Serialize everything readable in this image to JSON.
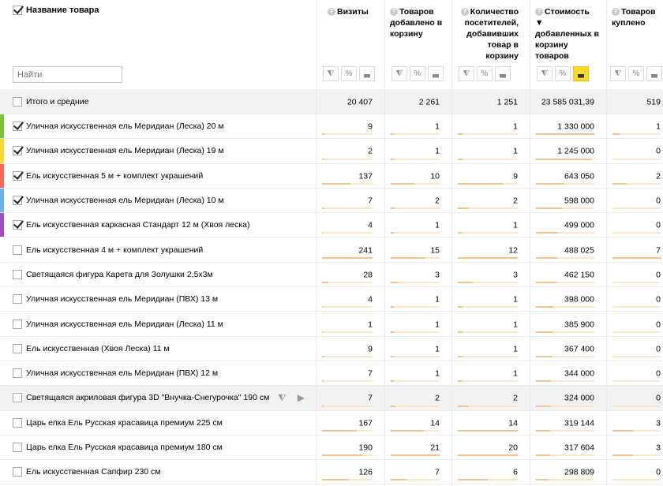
{
  "header": {
    "name_col": "Название товара",
    "search_placeholder": "Найти",
    "metrics": [
      {
        "title": "Визиты",
        "active_tool": false
      },
      {
        "title": "Товаров добавлено в корзину",
        "active_tool": false
      },
      {
        "title": "Количество посетителей, добавивших товар в корзину",
        "active_tool": false
      },
      {
        "title": "Стоимость ▼ добавленных в корзину товаров",
        "active_tool": true
      },
      {
        "title": "Товаров куплено",
        "active_tool": false
      }
    ],
    "tool_icons": [
      "filter-icon",
      "percent-icon",
      "chart-bars-icon"
    ]
  },
  "total": {
    "label": "Итого и средние",
    "values": [
      "20 407",
      "2 261",
      "1 251",
      "23 585 031,39",
      "519"
    ]
  },
  "rows": [
    {
      "label": "Уличная искусственная ель Меридиан (Леска) 20 м",
      "checked": true,
      "stripe": "#7cbf3a",
      "values": [
        "9",
        "1",
        "1",
        "1 330 000",
        "1"
      ],
      "fills": [
        0.04,
        0.07,
        0.08,
        1.0,
        0.14
      ]
    },
    {
      "label": "Уличная искусственная ель Меридиан (Леска) 19 м",
      "checked": true,
      "stripe": "#f5d93b",
      "values": [
        "2",
        "1",
        "1",
        "1 245 000",
        "0"
      ],
      "fills": [
        0.01,
        0.07,
        0.08,
        0.94,
        0
      ]
    },
    {
      "label": "Ель искусственная 5 м + комплект украшений",
      "checked": true,
      "stripe": "#f26b5b",
      "values": [
        "137",
        "10",
        "9",
        "643 050",
        "2"
      ],
      "fills": [
        0.57,
        0.48,
        0.75,
        0.48,
        0.29
      ]
    },
    {
      "label": "Уличная искусственная ель Меридиан (Леска) 10 м",
      "checked": true,
      "stripe": "#6fb1e8",
      "values": [
        "7",
        "2",
        "2",
        "598 000",
        "0"
      ],
      "fills": [
        0.03,
        0.1,
        0.17,
        0.45,
        0
      ]
    },
    {
      "label": "Ель искусственная каркасная Стандарт 12 м (Хвоя леска)",
      "checked": true,
      "stripe": "#9b4fc2",
      "values": [
        "4",
        "1",
        "1",
        "499 000",
        "0"
      ],
      "fills": [
        0.02,
        0.07,
        0.08,
        0.38,
        0
      ]
    },
    {
      "label": "Ель искусственная 4 м + комплект украшений",
      "checked": false,
      "stripe": "",
      "values": [
        "241",
        "15",
        "12",
        "488 025",
        "7"
      ],
      "fills": [
        1.0,
        0.71,
        1.0,
        0.37,
        1.0
      ]
    },
    {
      "label": "Светящаяся фигура Карета для Золушки 2,5х3м",
      "checked": false,
      "stripe": "",
      "values": [
        "28",
        "3",
        "3",
        "462 150",
        "0"
      ],
      "fills": [
        0.12,
        0.14,
        0.25,
        0.35,
        0
      ]
    },
    {
      "label": "Уличная искусственная ель Меридиан (ПВХ) 13 м",
      "checked": false,
      "stripe": "",
      "values": [
        "4",
        "1",
        "1",
        "398 000",
        "0"
      ],
      "fills": [
        0.02,
        0.07,
        0.08,
        0.3,
        0
      ]
    },
    {
      "label": "Уличная искусственная ель Меридиан (Леска) 11 м",
      "checked": false,
      "stripe": "",
      "values": [
        "1",
        "1",
        "1",
        "385 900",
        "0"
      ],
      "fills": [
        0.01,
        0.07,
        0.08,
        0.29,
        0
      ]
    },
    {
      "label": "Ель искусственная (Хвоя Леска) 11 м",
      "checked": false,
      "stripe": "",
      "values": [
        "9",
        "1",
        "1",
        "367 400",
        "0"
      ],
      "fills": [
        0.04,
        0.07,
        0.08,
        0.28,
        0
      ]
    },
    {
      "label": "Уличная искусственная ель Меридиан (ПВХ) 12 м",
      "checked": false,
      "stripe": "",
      "values": [
        "7",
        "1",
        "1",
        "344 000",
        "0"
      ],
      "fills": [
        0.03,
        0.07,
        0.08,
        0.26,
        0
      ]
    },
    {
      "label": "Светящаяся акриловая фигура 3D \"Внучка-Снегурочка\" 190 см",
      "checked": false,
      "stripe": "",
      "hover": true,
      "values": [
        "7",
        "2",
        "2",
        "324 000",
        "0"
      ],
      "fills": [
        0.03,
        0.1,
        0.17,
        0.24,
        0
      ]
    },
    {
      "label": "Царь елка Ель Русская красавица премиум 225 см",
      "checked": false,
      "stripe": "",
      "values": [
        "167",
        "14",
        "14",
        "319 144",
        "3"
      ],
      "fills": [
        0.69,
        0.67,
        1.0,
        0.24,
        0.43
      ]
    },
    {
      "label": "Царь елка Ель Русская красавица премиум 180 см",
      "checked": false,
      "stripe": "",
      "values": [
        "190",
        "21",
        "20",
        "317 604",
        "3"
      ],
      "fills": [
        0.79,
        1.0,
        1.0,
        0.24,
        0.43
      ]
    },
    {
      "label": "Ель искусственная Сапфир 230 см",
      "checked": false,
      "stripe": "",
      "values": [
        "126",
        "7",
        "6",
        "298 809",
        "0"
      ],
      "fills": [
        0.52,
        0.33,
        0.5,
        0.22,
        0
      ]
    }
  ]
}
